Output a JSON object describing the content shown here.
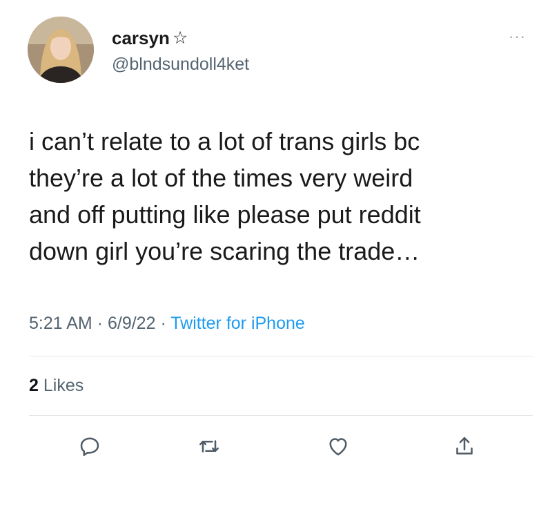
{
  "tweet": {
    "display_name": "carsyn",
    "name_emoji": "☆",
    "handle": "@blndsundoll4ket",
    "more_label": "···",
    "text_lines": [
      "i can’t relate to a lot of trans girls bc",
      "they’re a lot of the times very weird",
      "and off putting like please put reddit",
      "down girl you’re scaring the trade…"
    ],
    "time": "5:21 AM",
    "date": "6/9/22",
    "separator": "·",
    "source": "Twitter for iPhone",
    "likes_count": "2",
    "likes_label": "Likes"
  },
  "actions": [
    {
      "icon": "reply-icon"
    },
    {
      "icon": "retweet-icon"
    },
    {
      "icon": "like-icon"
    },
    {
      "icon": "share-icon"
    }
  ],
  "colors": {
    "text": "#0f1419",
    "secondary": "#536471",
    "link": "#1d9bf0",
    "divider": "#e3e7ea"
  }
}
